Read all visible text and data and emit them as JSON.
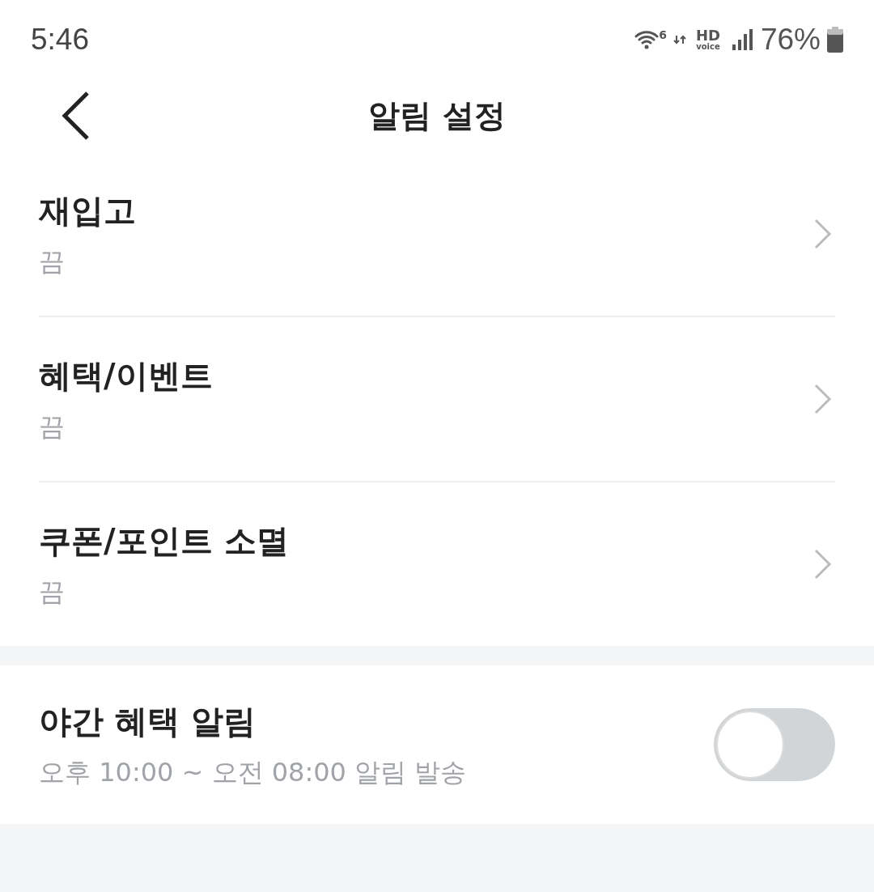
{
  "status_bar": {
    "time": "5:46",
    "wifi_label": "6",
    "hd": "HD",
    "voice": "voice",
    "battery": "76%"
  },
  "header": {
    "title": "알림 설정"
  },
  "items": [
    {
      "title": "재입고",
      "value": "끔"
    },
    {
      "title": "혜택/이벤트",
      "value": "끔"
    },
    {
      "title": "쿠폰/포인트 소멸",
      "value": "끔"
    }
  ],
  "night": {
    "title": "야간 혜택 알림",
    "description": "오후 10:00 ~ 오전 08:00 알림 발송",
    "on": false
  }
}
